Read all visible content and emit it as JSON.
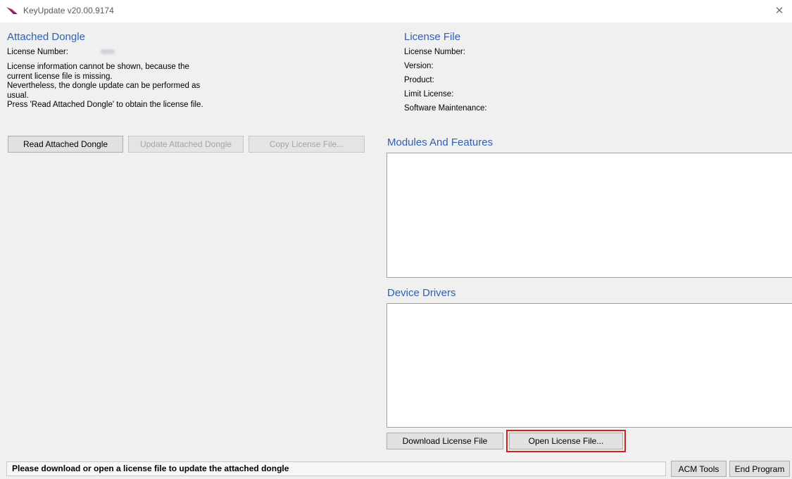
{
  "window": {
    "title": "KeyUpdate v20.00.9174",
    "close_glyph": "✕",
    "icon": "key-feather-icon"
  },
  "attached_dongle": {
    "heading": "Attached Dongle",
    "license_number_label": "License Number:",
    "message_lines": [
      "License information cannot be shown, because the",
      "current license file is missing.",
      "Nevertheless, the dongle update can be performed as",
      "usual.",
      "Press 'Read Attached Dongle' to obtain the license file."
    ],
    "buttons": {
      "read": "Read Attached Dongle",
      "update": "Update Attached Dongle",
      "copy": "Copy License File..."
    }
  },
  "license_file": {
    "heading": "License File",
    "fields": {
      "license_number": "License Number:",
      "version": "Version:",
      "product": "Product:",
      "limit_license": "Limit License:",
      "software_maintenance": "Software Maintenance:"
    }
  },
  "modules": {
    "heading": "Modules And Features"
  },
  "drivers": {
    "heading": "Device Drivers"
  },
  "actions": {
    "download": "Download License File",
    "open": "Open License File..."
  },
  "status": {
    "text": "Please download or open a license file to update the attached dongle"
  },
  "footer": {
    "acm_tools": "ACM Tools",
    "end_program": "End Program"
  },
  "colors": {
    "heading": "#2f5fb0",
    "highlight": "#d61f1f",
    "background": "#f0f0f0"
  }
}
